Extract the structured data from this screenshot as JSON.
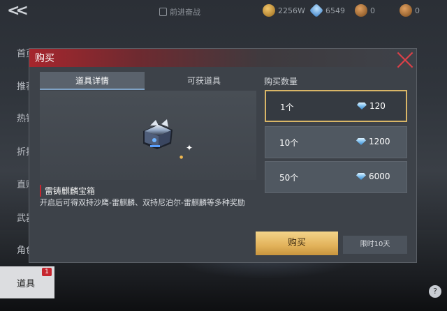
{
  "topbar": {
    "notice_text": "前进奋战",
    "currencies": [
      {
        "icon": "gold-coin-icon",
        "value": "2256W"
      },
      {
        "icon": "diamond-icon",
        "value": "6549"
      },
      {
        "icon": "bronze-coin-icon",
        "value": "0"
      },
      {
        "icon": "token-icon",
        "value": "0"
      }
    ]
  },
  "sidenav": {
    "items": [
      "首页",
      "推荐",
      "热销",
      "折扣",
      "直购",
      "武器",
      "角色"
    ],
    "active": {
      "label": "道具",
      "badge": "1"
    }
  },
  "dialog": {
    "title": "购买",
    "tabs": [
      "道具详情",
      "可获道具"
    ],
    "item_name": "雷铸麒麟宝箱",
    "item_desc": "开启后可得双持沙鹰-雷麒麟、双持尼泊尔-雷麒麟等多种奖励",
    "qty_title": "购买数量",
    "options": [
      {
        "label": "1个",
        "price": "120"
      },
      {
        "label": "10个",
        "price": "1200"
      },
      {
        "label": "50个",
        "price": "6000"
      }
    ],
    "buy_label": "购买",
    "limit_label": "限时10天"
  },
  "colors": {
    "accent_red": "#c6262f",
    "gold_button": "#e2b25a",
    "selected_border": "#d9b667"
  }
}
